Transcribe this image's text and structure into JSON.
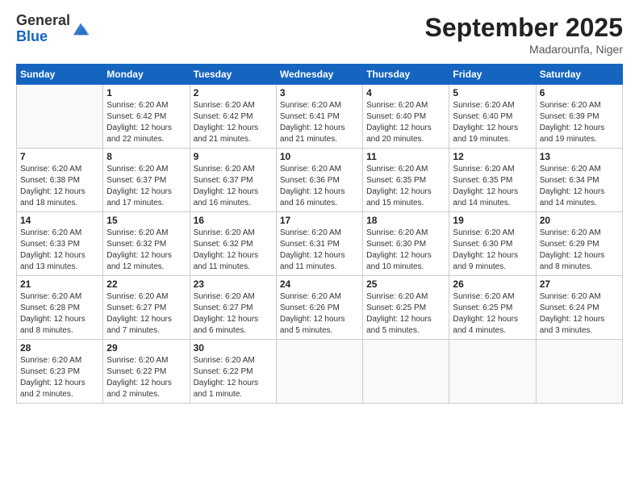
{
  "header": {
    "logo_general": "General",
    "logo_blue": "Blue",
    "month_title": "September 2025",
    "location": "Madarounfa, Niger"
  },
  "days_of_week": [
    "Sunday",
    "Monday",
    "Tuesday",
    "Wednesday",
    "Thursday",
    "Friday",
    "Saturday"
  ],
  "weeks": [
    [
      {
        "day": "",
        "info": ""
      },
      {
        "day": "1",
        "info": "Sunrise: 6:20 AM\nSunset: 6:42 PM\nDaylight: 12 hours\nand 22 minutes."
      },
      {
        "day": "2",
        "info": "Sunrise: 6:20 AM\nSunset: 6:42 PM\nDaylight: 12 hours\nand 21 minutes."
      },
      {
        "day": "3",
        "info": "Sunrise: 6:20 AM\nSunset: 6:41 PM\nDaylight: 12 hours\nand 21 minutes."
      },
      {
        "day": "4",
        "info": "Sunrise: 6:20 AM\nSunset: 6:40 PM\nDaylight: 12 hours\nand 20 minutes."
      },
      {
        "day": "5",
        "info": "Sunrise: 6:20 AM\nSunset: 6:40 PM\nDaylight: 12 hours\nand 19 minutes."
      },
      {
        "day": "6",
        "info": "Sunrise: 6:20 AM\nSunset: 6:39 PM\nDaylight: 12 hours\nand 19 minutes."
      }
    ],
    [
      {
        "day": "7",
        "info": "Sunrise: 6:20 AM\nSunset: 6:38 PM\nDaylight: 12 hours\nand 18 minutes."
      },
      {
        "day": "8",
        "info": "Sunrise: 6:20 AM\nSunset: 6:37 PM\nDaylight: 12 hours\nand 17 minutes."
      },
      {
        "day": "9",
        "info": "Sunrise: 6:20 AM\nSunset: 6:37 PM\nDaylight: 12 hours\nand 16 minutes."
      },
      {
        "day": "10",
        "info": "Sunrise: 6:20 AM\nSunset: 6:36 PM\nDaylight: 12 hours\nand 16 minutes."
      },
      {
        "day": "11",
        "info": "Sunrise: 6:20 AM\nSunset: 6:35 PM\nDaylight: 12 hours\nand 15 minutes."
      },
      {
        "day": "12",
        "info": "Sunrise: 6:20 AM\nSunset: 6:35 PM\nDaylight: 12 hours\nand 14 minutes."
      },
      {
        "day": "13",
        "info": "Sunrise: 6:20 AM\nSunset: 6:34 PM\nDaylight: 12 hours\nand 14 minutes."
      }
    ],
    [
      {
        "day": "14",
        "info": "Sunrise: 6:20 AM\nSunset: 6:33 PM\nDaylight: 12 hours\nand 13 minutes."
      },
      {
        "day": "15",
        "info": "Sunrise: 6:20 AM\nSunset: 6:32 PM\nDaylight: 12 hours\nand 12 minutes."
      },
      {
        "day": "16",
        "info": "Sunrise: 6:20 AM\nSunset: 6:32 PM\nDaylight: 12 hours\nand 11 minutes."
      },
      {
        "day": "17",
        "info": "Sunrise: 6:20 AM\nSunset: 6:31 PM\nDaylight: 12 hours\nand 11 minutes."
      },
      {
        "day": "18",
        "info": "Sunrise: 6:20 AM\nSunset: 6:30 PM\nDaylight: 12 hours\nand 10 minutes."
      },
      {
        "day": "19",
        "info": "Sunrise: 6:20 AM\nSunset: 6:30 PM\nDaylight: 12 hours\nand 9 minutes."
      },
      {
        "day": "20",
        "info": "Sunrise: 6:20 AM\nSunset: 6:29 PM\nDaylight: 12 hours\nand 8 minutes."
      }
    ],
    [
      {
        "day": "21",
        "info": "Sunrise: 6:20 AM\nSunset: 6:28 PM\nDaylight: 12 hours\nand 8 minutes."
      },
      {
        "day": "22",
        "info": "Sunrise: 6:20 AM\nSunset: 6:27 PM\nDaylight: 12 hours\nand 7 minutes."
      },
      {
        "day": "23",
        "info": "Sunrise: 6:20 AM\nSunset: 6:27 PM\nDaylight: 12 hours\nand 6 minutes."
      },
      {
        "day": "24",
        "info": "Sunrise: 6:20 AM\nSunset: 6:26 PM\nDaylight: 12 hours\nand 5 minutes."
      },
      {
        "day": "25",
        "info": "Sunrise: 6:20 AM\nSunset: 6:25 PM\nDaylight: 12 hours\nand 5 minutes."
      },
      {
        "day": "26",
        "info": "Sunrise: 6:20 AM\nSunset: 6:25 PM\nDaylight: 12 hours\nand 4 minutes."
      },
      {
        "day": "27",
        "info": "Sunrise: 6:20 AM\nSunset: 6:24 PM\nDaylight: 12 hours\nand 3 minutes."
      }
    ],
    [
      {
        "day": "28",
        "info": "Sunrise: 6:20 AM\nSunset: 6:23 PM\nDaylight: 12 hours\nand 2 minutes."
      },
      {
        "day": "29",
        "info": "Sunrise: 6:20 AM\nSunset: 6:22 PM\nDaylight: 12 hours\nand 2 minutes."
      },
      {
        "day": "30",
        "info": "Sunrise: 6:20 AM\nSunset: 6:22 PM\nDaylight: 12 hours\nand 1 minute."
      },
      {
        "day": "",
        "info": ""
      },
      {
        "day": "",
        "info": ""
      },
      {
        "day": "",
        "info": ""
      },
      {
        "day": "",
        "info": ""
      }
    ]
  ]
}
